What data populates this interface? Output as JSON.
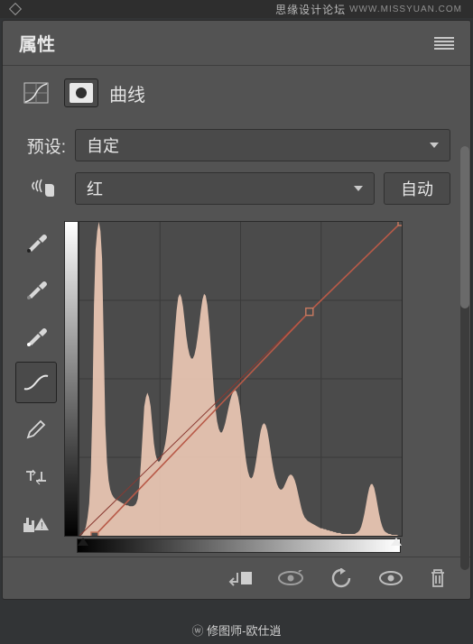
{
  "watermark_top": "思缘设计论坛",
  "watermark_url": "WWW.MISSYUAN.COM",
  "panel_title": "属性",
  "adjustment_label": "曲线",
  "preset_label": "预设:",
  "preset_value": "自定",
  "channel_value": "红",
  "auto_button": "自动",
  "credit": "修图师-欧仕逍",
  "chart_data": {
    "type": "curves",
    "channel": "red",
    "x_range": [
      0,
      255
    ],
    "y_range": [
      0,
      255
    ],
    "curve_points": [
      {
        "x": 12,
        "y": 0
      },
      {
        "x": 182,
        "y": 182
      },
      {
        "x": 255,
        "y": 255
      }
    ],
    "histogram": [
      0,
      0,
      2,
      5,
      10,
      20,
      35,
      70,
      140,
      250,
      310,
      330,
      340,
      330,
      300,
      210,
      120,
      80,
      60,
      50,
      45,
      42,
      40,
      39,
      38,
      37,
      36,
      35,
      34,
      33,
      33,
      32,
      32,
      32,
      33,
      35,
      40,
      55,
      80,
      110,
      140,
      150,
      155,
      150,
      140,
      120,
      100,
      88,
      82,
      80,
      82,
      86,
      92,
      100,
      112,
      128,
      148,
      172,
      198,
      222,
      244,
      258,
      262,
      258,
      248,
      232,
      216,
      204,
      196,
      192,
      192,
      196,
      204,
      216,
      230,
      244,
      256,
      262,
      260,
      250,
      232,
      208,
      182,
      158,
      138,
      124,
      116,
      112,
      112,
      116,
      122,
      130,
      138,
      146,
      152,
      156,
      158,
      156,
      150,
      140,
      126,
      110,
      94,
      80,
      70,
      64,
      62,
      64,
      70,
      80,
      92,
      104,
      114,
      120,
      122,
      120,
      114,
      104,
      92,
      80,
      70,
      62,
      56,
      52,
      50,
      50,
      52,
      56,
      60,
      64,
      66,
      66,
      64,
      60,
      54,
      46,
      38,
      30,
      24,
      20,
      18,
      16,
      15,
      14,
      13,
      12,
      11,
      10,
      9,
      8,
      8,
      7,
      7,
      6,
      6,
      5,
      5,
      4,
      4,
      3,
      3,
      3,
      2,
      2,
      2,
      2,
      2,
      2,
      2,
      2,
      2,
      3,
      4,
      6,
      10,
      16,
      24,
      34,
      44,
      52,
      56,
      56,
      52,
      44,
      34,
      24,
      16,
      10,
      6,
      4,
      3,
      2,
      2,
      1,
      1,
      1,
      1,
      0,
      0,
      0
    ]
  }
}
